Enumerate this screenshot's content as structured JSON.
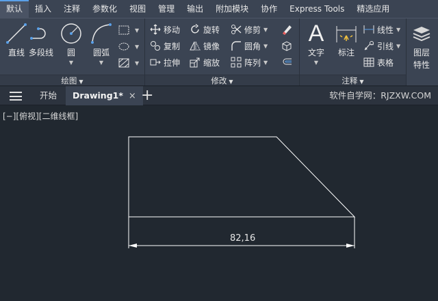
{
  "menu": {
    "tabs": [
      "默认",
      "插入",
      "注释",
      "参数化",
      "视图",
      "管理",
      "输出",
      "附加模块",
      "协作",
      "Express Tools",
      "精选应用"
    ],
    "active": "默认"
  },
  "ribbon": {
    "draw": {
      "title": "绘图",
      "line": "直线",
      "polyline": "多段线",
      "circle": "圆",
      "arc": "圆弧"
    },
    "modify": {
      "title": "修改",
      "move": "移动",
      "rotate": "旋转",
      "trim": "修剪",
      "copy": "复制",
      "mirror": "镜像",
      "fillet": "圆角",
      "stretch": "拉伸",
      "scale": "缩放",
      "array": "阵列"
    },
    "annotation": {
      "title": "注释",
      "text": "文字",
      "dimension": "标注",
      "linear": "线性",
      "leader": "引线",
      "table": "表格"
    },
    "layers": {
      "label_line1": "图层",
      "label_line2": "特性"
    }
  },
  "docbar": {
    "start_tab": "开始",
    "drawing_tab": "Drawing1*",
    "close_glyph": "×",
    "new_tab_glyph": "+",
    "watermark": "软件自学网：RJZXW.COM"
  },
  "viewport": {
    "label": "[−][俯视][二维线框]",
    "dimension_value": "82,16"
  },
  "colors": {
    "background": "#212830",
    "ribbon": "#3b4453",
    "accent": "#5aa0e8",
    "geometry": "#ffffff"
  }
}
